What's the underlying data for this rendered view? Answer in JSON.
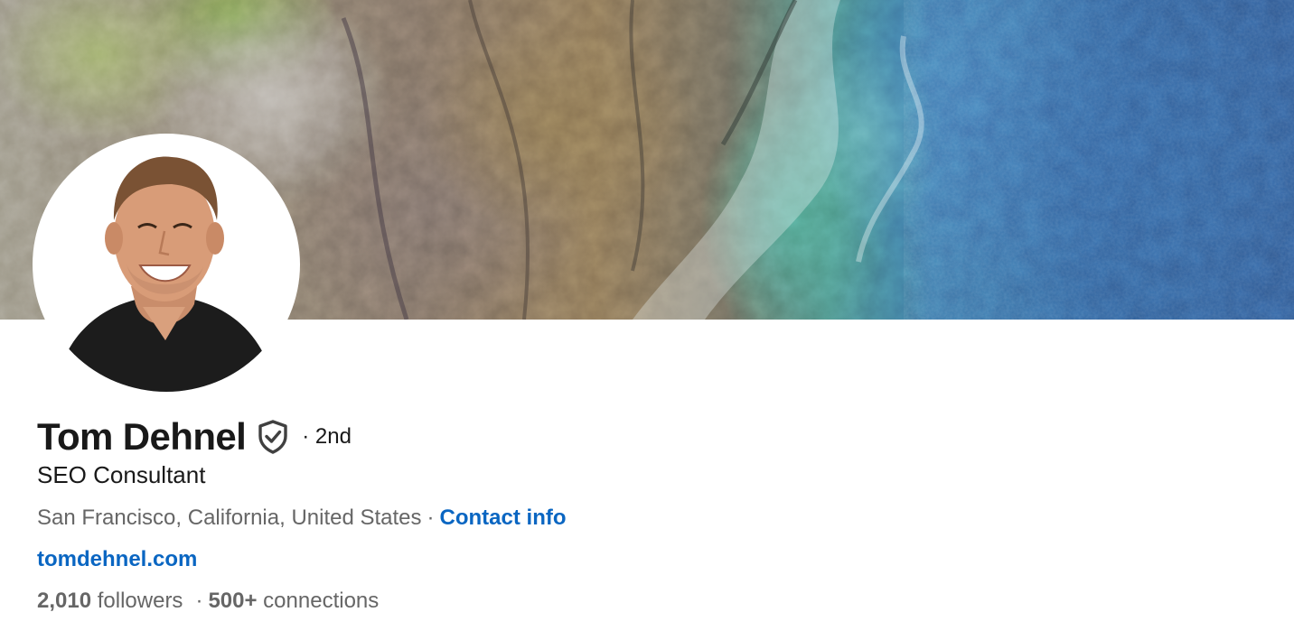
{
  "profile": {
    "name": "Tom Dehnel",
    "degree": "· 2nd",
    "headline": "SEO Consultant",
    "location": "San Francisco, California, United States",
    "separator": "·",
    "contact_info_label": "Contact info",
    "website": "tomdehnel.com",
    "followers_count": "2,010",
    "followers_label": "followers",
    "connections_count": "500+",
    "connections_label": "connections"
  },
  "colors": {
    "link": "#0a66c2",
    "primary_text": "#191919",
    "secondary_text": "#666666"
  },
  "icons": {
    "verified": "verified-shield-icon"
  }
}
